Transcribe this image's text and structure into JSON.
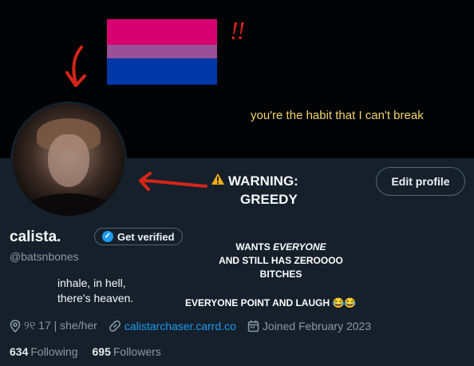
{
  "banner": {
    "exclaim": "!!",
    "quote": "you're the habit that I can't break",
    "flag_colors": [
      "#d60270",
      "#9b4f96",
      "#0038a8"
    ]
  },
  "overlay": {
    "warning_line1": "WARNING:",
    "warning_line2": "GREEDY",
    "caption_line1_a": "WANTS ",
    "caption_line1_b": "EVERYONE",
    "caption_line2": "AND STILL HAS ZEROOOO",
    "caption_line3": "BITCHES",
    "laugh": "EVERYONE POINT AND LAUGH 😂😂"
  },
  "profile": {
    "display_name": "calista.",
    "get_verified": "Get verified",
    "handle": "@batsnbones",
    "bio_line1": "inhale, in hell,",
    "bio_line2": "there's heaven.",
    "edit_profile": "Edit profile"
  },
  "meta": {
    "location": "୨୧ 17 | she/her",
    "link": "calistarchaser.carrd.co",
    "joined": "Joined February 2023"
  },
  "stats": {
    "following_count": "634",
    "following_label": "Following",
    "followers_count": "695",
    "followers_label": "Followers"
  },
  "colors": {
    "background": "#15202b",
    "accent": "#1d9bf0",
    "muted": "#8b98a5",
    "annotation_red": "#d6241a",
    "quote_yellow": "#f1d36a"
  }
}
